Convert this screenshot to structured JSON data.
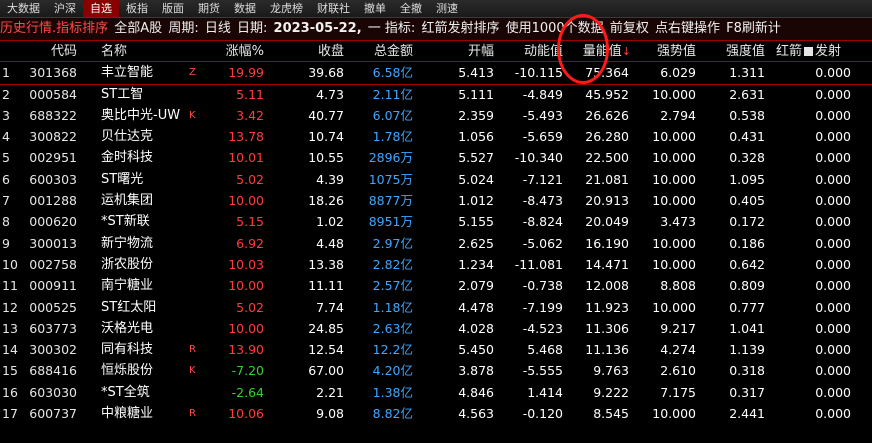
{
  "menu": [
    "大数据",
    "沪深",
    "自选",
    "板指",
    "版面",
    "期货",
    "数据",
    "龙虎榜",
    "财联社",
    "撤单",
    "全撤",
    "测速"
  ],
  "menu_active_index": 2,
  "info": {
    "title": "历史行情.指标排序",
    "block": "全部A股",
    "period_label": "周期:",
    "period": "日线",
    "date_label": "日期:",
    "date": "2023-05-22,",
    "indicator_label": "一 指标:",
    "indicator": "红箭发射排序",
    "usage": "使用1000个数据",
    "adjust": "前复权",
    "hint": "点右键操作",
    "refresh": "F8刷新计"
  },
  "headers": {
    "code": "代码",
    "name": "名称",
    "chg": "涨幅%",
    "close": "收盘",
    "amount": "总金额",
    "open": "开幅",
    "dyn": "动能值",
    "vol": "量能值",
    "vol_arrow": "↓",
    "str": "强势值",
    "int": "强度值",
    "sig_pre": "红箭",
    "sig_post": "发射"
  },
  "rows": [
    {
      "idx": "1",
      "code": "301368",
      "name": "丰立智能",
      "flag": "Z",
      "chg": "19.99",
      "close": "39.68",
      "amount": "6.58亿",
      "open": "5.413",
      "dyn": "-10.115",
      "vol": "75.364",
      "str": "6.029",
      "int": "1.311",
      "sig": "0.000",
      "dir": "up"
    },
    {
      "idx": "2",
      "code": "000584",
      "name": "ST工智",
      "flag": "",
      "chg": "5.11",
      "close": "4.73",
      "amount": "2.11亿",
      "open": "5.111",
      "dyn": "-4.849",
      "vol": "45.952",
      "str": "10.000",
      "int": "2.631",
      "sig": "0.000",
      "dir": "up"
    },
    {
      "idx": "3",
      "code": "688322",
      "name": "奥比中光-UW",
      "flag": "K",
      "chg": "3.42",
      "close": "40.77",
      "amount": "6.07亿",
      "open": "2.359",
      "dyn": "-5.493",
      "vol": "26.626",
      "str": "2.794",
      "int": "0.538",
      "sig": "0.000",
      "dir": "up"
    },
    {
      "idx": "4",
      "code": "300822",
      "name": "贝仕达克",
      "flag": "",
      "chg": "13.78",
      "close": "10.74",
      "amount": "1.78亿",
      "open": "1.056",
      "dyn": "-5.659",
      "vol": "26.280",
      "str": "10.000",
      "int": "0.431",
      "sig": "0.000",
      "dir": "up"
    },
    {
      "idx": "5",
      "code": "002951",
      "name": "金时科技",
      "flag": "",
      "chg": "10.01",
      "close": "10.55",
      "amount": "2896万",
      "open": "5.527",
      "dyn": "-10.340",
      "vol": "22.500",
      "str": "10.000",
      "int": "0.328",
      "sig": "0.000",
      "dir": "up"
    },
    {
      "idx": "6",
      "code": "600303",
      "name": "ST曙光",
      "flag": "",
      "chg": "5.02",
      "close": "4.39",
      "amount": "1075万",
      "open": "5.024",
      "dyn": "-7.121",
      "vol": "21.081",
      "str": "10.000",
      "int": "1.095",
      "sig": "0.000",
      "dir": "up"
    },
    {
      "idx": "7",
      "code": "001288",
      "name": "运机集团",
      "flag": "",
      "chg": "10.00",
      "close": "18.26",
      "amount": "8877万",
      "open": "1.012",
      "dyn": "-8.473",
      "vol": "20.913",
      "str": "10.000",
      "int": "0.405",
      "sig": "0.000",
      "dir": "up"
    },
    {
      "idx": "8",
      "code": "000620",
      "name": "*ST新联",
      "flag": "",
      "chg": "5.15",
      "close": "1.02",
      "amount": "8951万",
      "open": "5.155",
      "dyn": "-8.824",
      "vol": "20.049",
      "str": "3.473",
      "int": "0.172",
      "sig": "0.000",
      "dir": "up"
    },
    {
      "idx": "9",
      "code": "300013",
      "name": "新宁物流",
      "flag": "",
      "chg": "6.92",
      "close": "4.48",
      "amount": "2.97亿",
      "open": "2.625",
      "dyn": "-5.062",
      "vol": "16.190",
      "str": "10.000",
      "int": "0.186",
      "sig": "0.000",
      "dir": "up"
    },
    {
      "idx": "10",
      "code": "002758",
      "name": "浙农股份",
      "flag": "",
      "chg": "10.03",
      "close": "13.38",
      "amount": "2.82亿",
      "open": "1.234",
      "dyn": "-11.081",
      "vol": "14.471",
      "str": "10.000",
      "int": "0.642",
      "sig": "0.000",
      "dir": "up"
    },
    {
      "idx": "11",
      "code": "000911",
      "name": "南宁糖业",
      "flag": "",
      "chg": "10.00",
      "close": "11.11",
      "amount": "2.57亿",
      "open": "2.079",
      "dyn": "-0.738",
      "vol": "12.008",
      "str": "8.808",
      "int": "0.809",
      "sig": "0.000",
      "dir": "up"
    },
    {
      "idx": "12",
      "code": "000525",
      "name": "ST红太阳",
      "flag": "",
      "chg": "5.02",
      "close": "7.74",
      "amount": "1.18亿",
      "open": "4.478",
      "dyn": "-7.199",
      "vol": "11.923",
      "str": "10.000",
      "int": "0.777",
      "sig": "0.000",
      "dir": "up"
    },
    {
      "idx": "13",
      "code": "603773",
      "name": "沃格光电",
      "flag": "",
      "chg": "10.00",
      "close": "24.85",
      "amount": "2.63亿",
      "open": "4.028",
      "dyn": "-4.523",
      "vol": "11.306",
      "str": "9.217",
      "int": "1.041",
      "sig": "0.000",
      "dir": "up"
    },
    {
      "idx": "14",
      "code": "300302",
      "name": "同有科技",
      "flag": "R",
      "chg": "13.90",
      "close": "12.54",
      "amount": "12.2亿",
      "open": "5.450",
      "dyn": "5.468",
      "vol": "11.136",
      "str": "4.274",
      "int": "1.139",
      "sig": "0.000",
      "dir": "up"
    },
    {
      "idx": "15",
      "code": "688416",
      "name": "恒烁股份",
      "flag": "K",
      "chg": "-7.20",
      "close": "67.00",
      "amount": "4.20亿",
      "open": "3.878",
      "dyn": "-5.555",
      "vol": "9.763",
      "str": "2.610",
      "int": "0.318",
      "sig": "0.000",
      "dir": "down"
    },
    {
      "idx": "16",
      "code": "603030",
      "name": "*ST全筑",
      "flag": "",
      "chg": "-2.64",
      "close": "2.21",
      "amount": "1.38亿",
      "open": "4.846",
      "dyn": "1.414",
      "vol": "9.222",
      "str": "7.175",
      "int": "0.317",
      "sig": "0.000",
      "dir": "down"
    },
    {
      "idx": "17",
      "code": "600737",
      "name": "中粮糖业",
      "flag": "R",
      "chg": "10.06",
      "close": "9.08",
      "amount": "8.82亿",
      "open": "4.563",
      "dyn": "-0.120",
      "vol": "8.545",
      "str": "10.000",
      "int": "2.441",
      "sig": "0.000",
      "dir": "up"
    }
  ],
  "colors": {
    "up": "#ff3b3b",
    "down": "#31d231",
    "amount": "#3fa6ff",
    "annotation": "#ff1a1a"
  }
}
